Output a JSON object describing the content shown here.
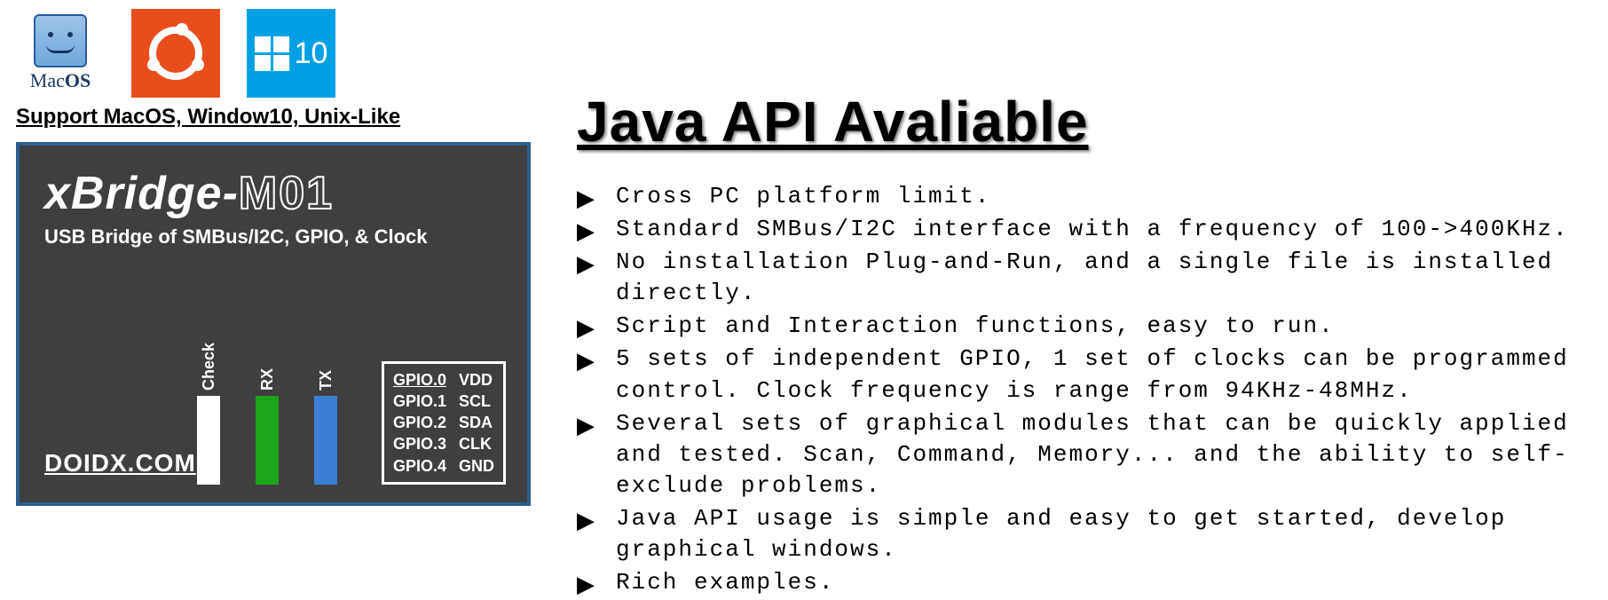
{
  "os_support_line": "Support MacOS, Window10, Unix-Like",
  "os_badges": {
    "macos_label": "Mac OS",
    "win_label": "10"
  },
  "device": {
    "title_prefix": "xBridge-",
    "title_model": "M01",
    "subtitle": "USB Bridge of SMBus/I2C, GPIO, & Clock",
    "domain": "DOIDX.COM",
    "leds": [
      {
        "label": "Check",
        "color": "white"
      },
      {
        "label": "RX",
        "color": "green"
      },
      {
        "label": "TX",
        "color": "blue"
      }
    ],
    "pins": [
      {
        "gpio": "GPIO.0",
        "sig": "VDD"
      },
      {
        "gpio": "GPIO.1",
        "sig": "SCL"
      },
      {
        "gpio": "GPIO.2",
        "sig": "SDA"
      },
      {
        "gpio": "GPIO.3",
        "sig": "CLK"
      },
      {
        "gpio": "GPIO.4",
        "sig": "GND"
      }
    ]
  },
  "api_title": "Java API Avaliable",
  "bullets": [
    "Cross PC platform limit.",
    "Standard SMBus/I2C interface with a frequency of 100->400KHz.",
    "No installation Plug-and-Run, and a single file is installed directly.",
    "Script and Interaction functions, easy to run.",
    "5 sets of independent GPIO, 1 set of clocks can be programmed control. Clock frequency is range from 94KHz-48MHz.",
    "Several sets of graphical modules that can be quickly applied and tested. Scan, Command, Memory... and the ability to self-exclude problems.",
    "Java API usage is simple and easy to get started, develop graphical windows.",
    "Rich examples."
  ]
}
